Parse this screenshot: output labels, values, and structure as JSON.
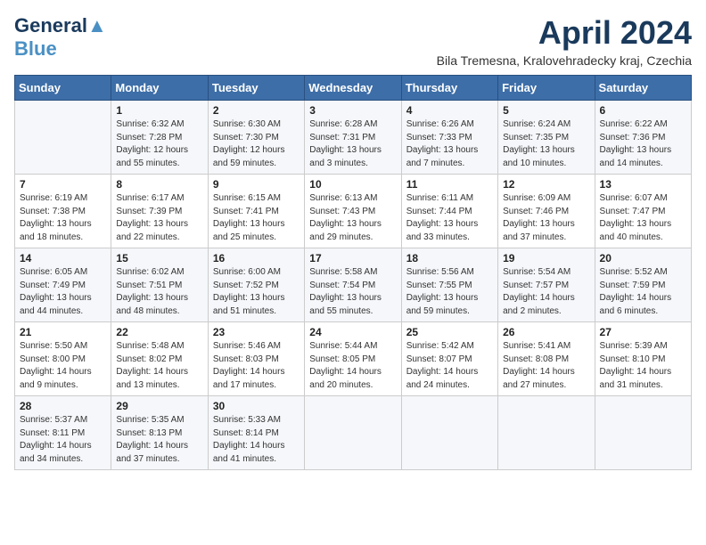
{
  "logo": {
    "part1": "General",
    "part2": "Blue"
  },
  "title": "April 2024",
  "location": "Bila Tremesna, Kralovehradecky kraj, Czechia",
  "headers": [
    "Sunday",
    "Monday",
    "Tuesday",
    "Wednesday",
    "Thursday",
    "Friday",
    "Saturday"
  ],
  "weeks": [
    [
      {
        "day": "",
        "sunrise": "",
        "sunset": "",
        "daylight": ""
      },
      {
        "day": "1",
        "sunrise": "Sunrise: 6:32 AM",
        "sunset": "Sunset: 7:28 PM",
        "daylight": "Daylight: 12 hours and 55 minutes."
      },
      {
        "day": "2",
        "sunrise": "Sunrise: 6:30 AM",
        "sunset": "Sunset: 7:30 PM",
        "daylight": "Daylight: 12 hours and 59 minutes."
      },
      {
        "day": "3",
        "sunrise": "Sunrise: 6:28 AM",
        "sunset": "Sunset: 7:31 PM",
        "daylight": "Daylight: 13 hours and 3 minutes."
      },
      {
        "day": "4",
        "sunrise": "Sunrise: 6:26 AM",
        "sunset": "Sunset: 7:33 PM",
        "daylight": "Daylight: 13 hours and 7 minutes."
      },
      {
        "day": "5",
        "sunrise": "Sunrise: 6:24 AM",
        "sunset": "Sunset: 7:35 PM",
        "daylight": "Daylight: 13 hours and 10 minutes."
      },
      {
        "day": "6",
        "sunrise": "Sunrise: 6:22 AM",
        "sunset": "Sunset: 7:36 PM",
        "daylight": "Daylight: 13 hours and 14 minutes."
      }
    ],
    [
      {
        "day": "7",
        "sunrise": "Sunrise: 6:19 AM",
        "sunset": "Sunset: 7:38 PM",
        "daylight": "Daylight: 13 hours and 18 minutes."
      },
      {
        "day": "8",
        "sunrise": "Sunrise: 6:17 AM",
        "sunset": "Sunset: 7:39 PM",
        "daylight": "Daylight: 13 hours and 22 minutes."
      },
      {
        "day": "9",
        "sunrise": "Sunrise: 6:15 AM",
        "sunset": "Sunset: 7:41 PM",
        "daylight": "Daylight: 13 hours and 25 minutes."
      },
      {
        "day": "10",
        "sunrise": "Sunrise: 6:13 AM",
        "sunset": "Sunset: 7:43 PM",
        "daylight": "Daylight: 13 hours and 29 minutes."
      },
      {
        "day": "11",
        "sunrise": "Sunrise: 6:11 AM",
        "sunset": "Sunset: 7:44 PM",
        "daylight": "Daylight: 13 hours and 33 minutes."
      },
      {
        "day": "12",
        "sunrise": "Sunrise: 6:09 AM",
        "sunset": "Sunset: 7:46 PM",
        "daylight": "Daylight: 13 hours and 37 minutes."
      },
      {
        "day": "13",
        "sunrise": "Sunrise: 6:07 AM",
        "sunset": "Sunset: 7:47 PM",
        "daylight": "Daylight: 13 hours and 40 minutes."
      }
    ],
    [
      {
        "day": "14",
        "sunrise": "Sunrise: 6:05 AM",
        "sunset": "Sunset: 7:49 PM",
        "daylight": "Daylight: 13 hours and 44 minutes."
      },
      {
        "day": "15",
        "sunrise": "Sunrise: 6:02 AM",
        "sunset": "Sunset: 7:51 PM",
        "daylight": "Daylight: 13 hours and 48 minutes."
      },
      {
        "day": "16",
        "sunrise": "Sunrise: 6:00 AM",
        "sunset": "Sunset: 7:52 PM",
        "daylight": "Daylight: 13 hours and 51 minutes."
      },
      {
        "day": "17",
        "sunrise": "Sunrise: 5:58 AM",
        "sunset": "Sunset: 7:54 PM",
        "daylight": "Daylight: 13 hours and 55 minutes."
      },
      {
        "day": "18",
        "sunrise": "Sunrise: 5:56 AM",
        "sunset": "Sunset: 7:55 PM",
        "daylight": "Daylight: 13 hours and 59 minutes."
      },
      {
        "day": "19",
        "sunrise": "Sunrise: 5:54 AM",
        "sunset": "Sunset: 7:57 PM",
        "daylight": "Daylight: 14 hours and 2 minutes."
      },
      {
        "day": "20",
        "sunrise": "Sunrise: 5:52 AM",
        "sunset": "Sunset: 7:59 PM",
        "daylight": "Daylight: 14 hours and 6 minutes."
      }
    ],
    [
      {
        "day": "21",
        "sunrise": "Sunrise: 5:50 AM",
        "sunset": "Sunset: 8:00 PM",
        "daylight": "Daylight: 14 hours and 9 minutes."
      },
      {
        "day": "22",
        "sunrise": "Sunrise: 5:48 AM",
        "sunset": "Sunset: 8:02 PM",
        "daylight": "Daylight: 14 hours and 13 minutes."
      },
      {
        "day": "23",
        "sunrise": "Sunrise: 5:46 AM",
        "sunset": "Sunset: 8:03 PM",
        "daylight": "Daylight: 14 hours and 17 minutes."
      },
      {
        "day": "24",
        "sunrise": "Sunrise: 5:44 AM",
        "sunset": "Sunset: 8:05 PM",
        "daylight": "Daylight: 14 hours and 20 minutes."
      },
      {
        "day": "25",
        "sunrise": "Sunrise: 5:42 AM",
        "sunset": "Sunset: 8:07 PM",
        "daylight": "Daylight: 14 hours and 24 minutes."
      },
      {
        "day": "26",
        "sunrise": "Sunrise: 5:41 AM",
        "sunset": "Sunset: 8:08 PM",
        "daylight": "Daylight: 14 hours and 27 minutes."
      },
      {
        "day": "27",
        "sunrise": "Sunrise: 5:39 AM",
        "sunset": "Sunset: 8:10 PM",
        "daylight": "Daylight: 14 hours and 31 minutes."
      }
    ],
    [
      {
        "day": "28",
        "sunrise": "Sunrise: 5:37 AM",
        "sunset": "Sunset: 8:11 PM",
        "daylight": "Daylight: 14 hours and 34 minutes."
      },
      {
        "day": "29",
        "sunrise": "Sunrise: 5:35 AM",
        "sunset": "Sunset: 8:13 PM",
        "daylight": "Daylight: 14 hours and 37 minutes."
      },
      {
        "day": "30",
        "sunrise": "Sunrise: 5:33 AM",
        "sunset": "Sunset: 8:14 PM",
        "daylight": "Daylight: 14 hours and 41 minutes."
      },
      {
        "day": "",
        "sunrise": "",
        "sunset": "",
        "daylight": ""
      },
      {
        "day": "",
        "sunrise": "",
        "sunset": "",
        "daylight": ""
      },
      {
        "day": "",
        "sunrise": "",
        "sunset": "",
        "daylight": ""
      },
      {
        "day": "",
        "sunrise": "",
        "sunset": "",
        "daylight": ""
      }
    ]
  ]
}
